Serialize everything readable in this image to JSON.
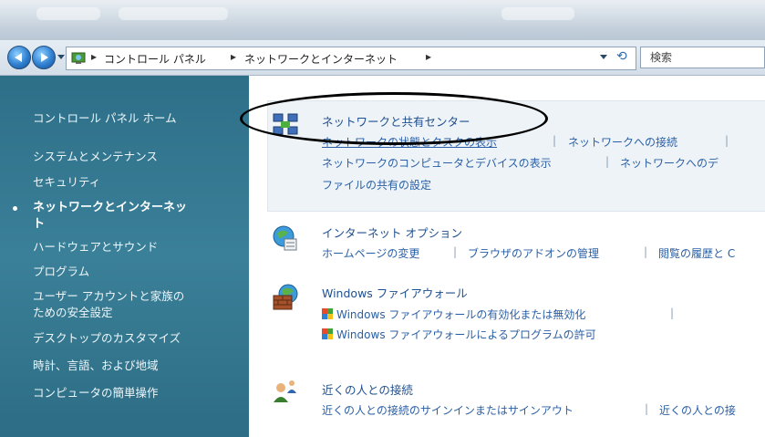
{
  "address": {
    "crumbs": [
      "コントロール パネル",
      "ネットワークとインターネット"
    ],
    "separator": "▸",
    "search_placeholder": "検索"
  },
  "sidebar": {
    "items": [
      {
        "label": "コントロール パネル ホーム"
      },
      {
        "label": "システムとメンテナンス"
      },
      {
        "label": "セキュリティ"
      },
      {
        "label_line1": "ネットワークとインターネッ",
        "label_line2": "ト"
      },
      {
        "label": "ハードウェアとサウンド"
      },
      {
        "label": "プログラム"
      },
      {
        "label_line1": "ユーザー アカウントと家族の",
        "label_line2": "ための安全設定"
      },
      {
        "label": "デスクトップのカスタマイズ"
      },
      {
        "label": "時計、言語、および地域"
      },
      {
        "label": "コンピュータの簡単操作"
      }
    ]
  },
  "categories": {
    "network_center": {
      "title": "ネットワークと共有センター",
      "links_row1": [
        "ネットワークの状態とタスクの表示",
        "ネットワークへの接続"
      ],
      "links_row2": [
        "ネットワークのコンピュータとデバイスの表示",
        "ネットワークへのデ"
      ],
      "links_row3": [
        "ファイルの共有の設定"
      ]
    },
    "internet_options": {
      "title": "インターネット オプション",
      "links": [
        "ホームページの変更",
        "ブラウザのアドオンの管理",
        "閲覧の履歴と C"
      ]
    },
    "firewall": {
      "title": "Windows ファイアウォール",
      "links": [
        "Windows ファイアウォールの有効化または無効化",
        "Windows ファイアウォールによるプログラムの許可"
      ]
    },
    "people_near_me": {
      "title": "近くの人との接続",
      "links": [
        "近くの人との接続のサインインまたはサインアウト",
        "近くの人との接"
      ]
    }
  },
  "colors": {
    "sidebar_bg": "#3a8098",
    "link": "#2a5fa5",
    "title_link": "#1e4f8e",
    "highlight_bg": "#eef3f8"
  }
}
